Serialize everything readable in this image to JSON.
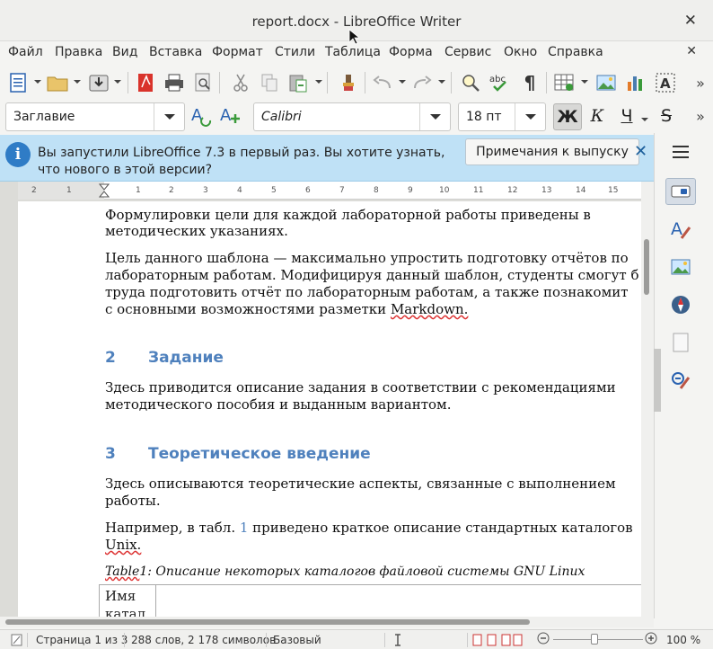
{
  "window": {
    "title": "report.docx - LibreOffice Writer"
  },
  "menu": {
    "items": [
      "Файл",
      "Правка",
      "Вид",
      "Вставка",
      "Формат",
      "Стили",
      "Таблица",
      "Форма",
      "Сервис",
      "Окно",
      "Справка"
    ]
  },
  "format": {
    "paragraph_style": "Заглавие",
    "font_name": "Calibri",
    "font_size": "18 пт",
    "bold_glyph": "Ж",
    "italic_glyph": "К",
    "underline_glyph": "Ч",
    "strike_glyph": "S"
  },
  "infobar": {
    "message": "Вы запустили LibreOffice 7.3 в первый раз. Вы хотите узнать, что нового в этой версии?",
    "button_label": "Примечания к выпуску"
  },
  "ruler": {
    "labels": [
      "2",
      "1",
      "1",
      "1",
      "2",
      "3",
      "4",
      "5",
      "6",
      "7",
      "8",
      "9",
      "10",
      "11",
      "12",
      "13",
      "14",
      "15"
    ]
  },
  "document": {
    "para1": [
      "Формулировки цели для каждой лабораторной работы приведены в",
      "методических указаниях."
    ],
    "para2": [
      "Цель данного шаблона — максимально упростить подготовку отчётов по",
      "лабораторным работам. Модифицируя данный шаблон, студенты смогут б",
      "труда подготовить отчёт по лабораторным работам, а также познакомит",
      "с основными возможностями разметки "
    ],
    "para2_markdown": "Markdown.",
    "h2_num": "2",
    "h2_title": "Задание",
    "para3": [
      "Здесь приводится описание задания в соответствии с рекомендациями",
      "методического пособия и выданным вариантом."
    ],
    "h3_num": "3",
    "h3_title": "Теоретическое введение",
    "para4": [
      "Здесь описываются теоретические аспекты, связанные с выполнением",
      "работы."
    ],
    "para5_a": "Например, в табл. ",
    "para5_ref": "1",
    "para5_b": " приведено краткое описание стандартных каталогов",
    "para5_unix": "Unix.",
    "caption_table": "Table",
    "caption_rest": "1: Описание некоторых каталогов файловой системы GNU Linux",
    "table_cell": [
      "Имя",
      "катал"
    ]
  },
  "status": {
    "page": "Страница 1 из 3",
    "words": "288 слов, 2 178 символов",
    "style": "Базовый",
    "zoom": "100 %"
  },
  "colors": {
    "heading": "#4f81bd",
    "infobar": "#bfe1f6"
  }
}
